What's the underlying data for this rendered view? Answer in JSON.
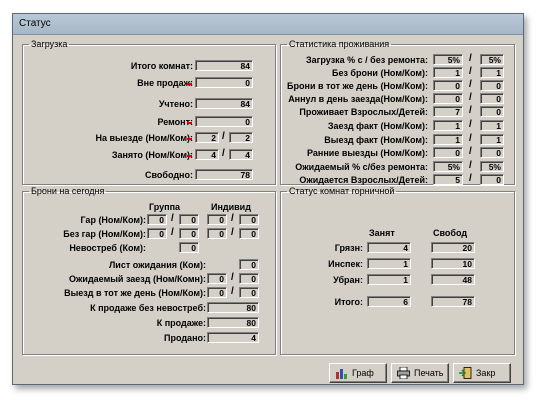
{
  "window": {
    "title": "Статус"
  },
  "load": {
    "legend": "Загрузка",
    "rows": [
      {
        "label": "Итого комнат:",
        "v": [
          "84"
        ]
      },
      {
        "label": "Вне продаж:",
        "v": [
          "0"
        ]
      },
      {
        "label": "Учтено:",
        "v": [
          "84"
        ]
      },
      {
        "label": "Ремонт:",
        "v": [
          "0"
        ]
      },
      {
        "label": "На выезде (Ном/Ком):",
        "v": [
          "2",
          "2"
        ]
      },
      {
        "label": "Занято (Ном/Ком):",
        "v": [
          "4",
          "4"
        ]
      },
      {
        "label": "Свободно:",
        "v": [
          "78"
        ]
      }
    ]
  },
  "stay": {
    "legend": "Статистика проживания",
    "rows": [
      {
        "label": "Загрузка % с / без ремонта:",
        "v": [
          "5%",
          "5%"
        ]
      },
      {
        "label": "Без брони (Ном/Ком):",
        "v": [
          "1",
          "1"
        ]
      },
      {
        "label": "Брони в тот же день (Ном/Ком):",
        "v": [
          "0",
          "0"
        ]
      },
      {
        "label": "Аннул в день заезда(Ном/Ком):",
        "v": [
          "0",
          "0"
        ]
      },
      {
        "label": "Проживает Взрослых/Детей:",
        "v": [
          "7",
          "0"
        ]
      },
      {
        "label": "Заезд факт (Ном/Ком):",
        "v": [
          "1",
          "1"
        ]
      },
      {
        "label": "Выезд факт (Ном/Ком):",
        "v": [
          "1",
          "1"
        ]
      },
      {
        "label": "Ранние выезды (Ном/Ком):",
        "v": [
          "0",
          "0"
        ]
      },
      {
        "label": "Ожидаемый % с/без ремонта:",
        "v": [
          "5%",
          "5%"
        ]
      },
      {
        "label": "Ожидается Взрослых/Детей:",
        "v": [
          "5",
          "0"
        ]
      }
    ]
  },
  "today": {
    "legend": "Брони на сегодня",
    "group_header": "Группа",
    "indiv_header": "Индивид",
    "rows": [
      {
        "label": "Гар (Ном/Ком):",
        "v": [
          "0",
          "0",
          "0",
          "0"
        ]
      },
      {
        "label": "Без гар (Ном/Ком):",
        "v": [
          "0",
          "0",
          "0",
          "0"
        ]
      },
      {
        "label": "Невостреб (Ком):",
        "v": [
          "0"
        ]
      },
      {
        "label": "Лист ожидания (Ком):",
        "v": [
          "0"
        ]
      },
      {
        "label": "Ожидаемый заезд (Ном/Комн):",
        "v": [
          "0",
          "0"
        ]
      },
      {
        "label": "Выезд в тот же день (Ном/Ком):",
        "v": [
          "0",
          "0"
        ]
      },
      {
        "label": "К продаже без невостреб:",
        "v": [
          "80"
        ]
      },
      {
        "label": "К продаже:",
        "v": [
          "80"
        ]
      },
      {
        "label": "Продано:",
        "v": [
          "4"
        ]
      }
    ]
  },
  "maid": {
    "legend": "Статус комнат горничной",
    "occupied": "Занят",
    "free": "Свобод",
    "rows": [
      {
        "label": "Грязн:",
        "v": [
          "4",
          "20"
        ]
      },
      {
        "label": "Инспек:",
        "v": [
          "1",
          "10"
        ]
      },
      {
        "label": "Убран:",
        "v": [
          "1",
          "48"
        ]
      },
      {
        "label": "Итого:",
        "v": [
          "6",
          "78"
        ]
      }
    ]
  },
  "buttons": {
    "graph": "Граф",
    "print": "Печать",
    "close": "Закр"
  },
  "colors": {
    "marker": "#e00000",
    "face": "#d4d0c8"
  }
}
